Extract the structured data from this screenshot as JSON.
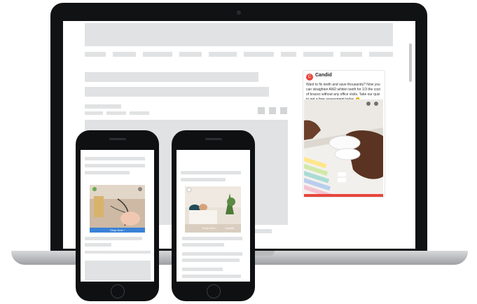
{
  "ad": {
    "logo_text": "C",
    "brand": "Candid",
    "copy": "Want to fix teeth and save thousands? Now you can straighten AND whiten teeth for 1/3 the cost of braces without any office visits. Take our quiz to get a free assessment today. 😊",
    "accent": "#e8453c"
  },
  "phone_left": {
    "cta": "Shop Now ›",
    "cta_color": "#3b82d6"
  },
  "phone_right": {
    "cta": "Shop Now ›",
    "caption": "Wayfair Collections"
  }
}
